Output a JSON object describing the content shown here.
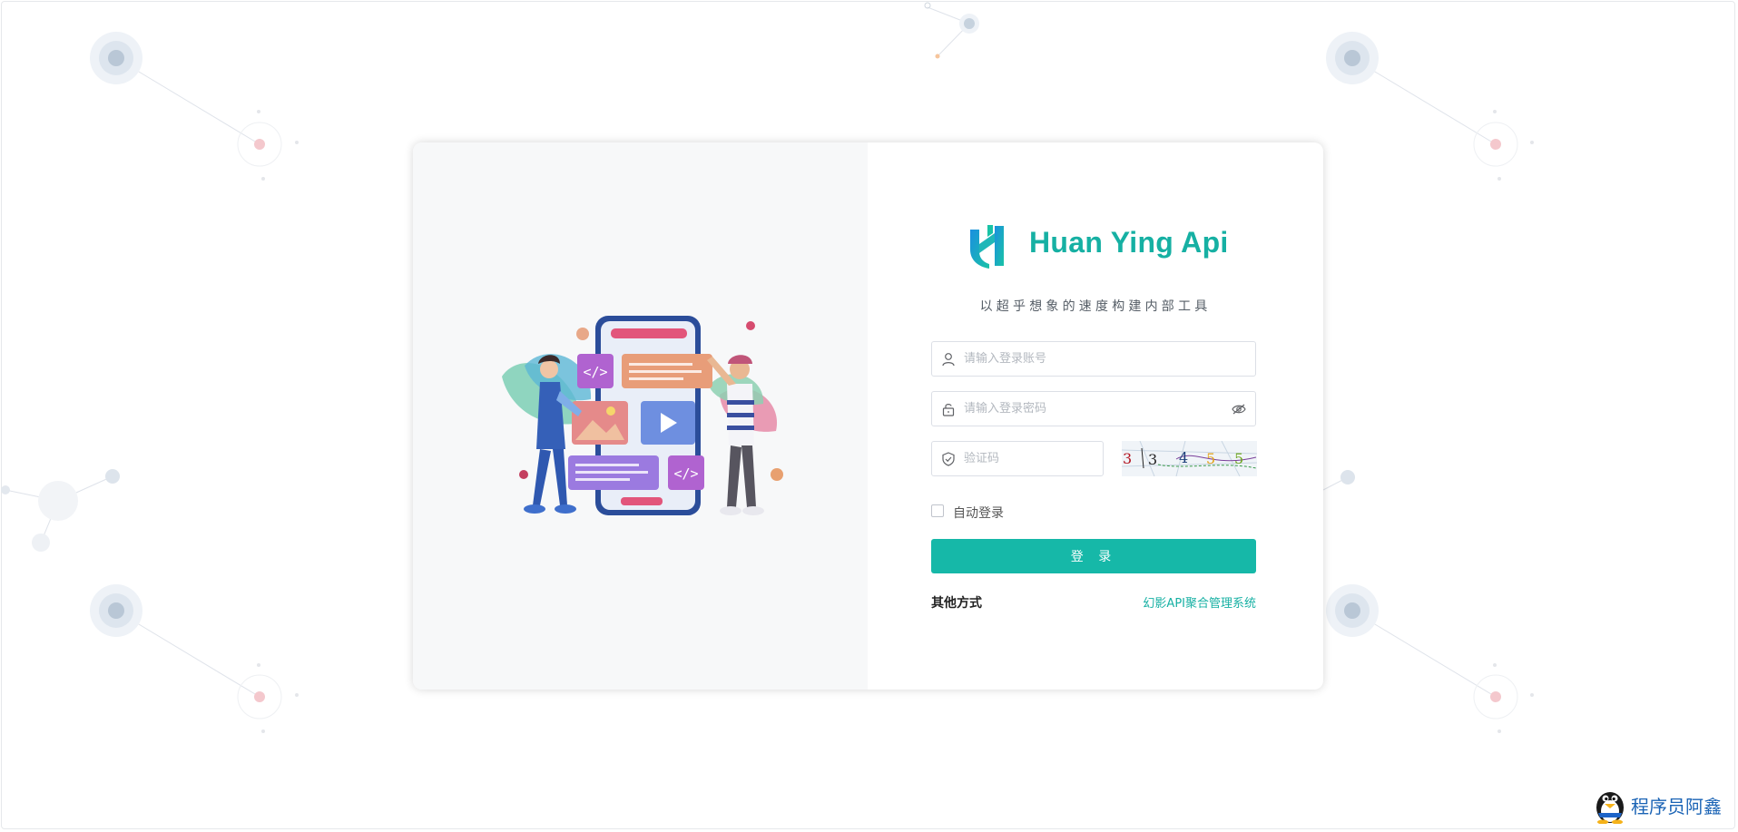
{
  "brand": {
    "name": "Huan Ying Api",
    "slogan": "以超乎想象的速度构建内部工具"
  },
  "form": {
    "username_placeholder": "请输入登录账号",
    "password_placeholder": "请输入登录密码",
    "captcha_placeholder": "验证码",
    "captcha_text": "3 3 4 5 5",
    "remember_label": "自动登录",
    "remember_checked": false,
    "login_label": "登 录",
    "other_methods_label": "其他方式",
    "system_link_label": "幻影API聚合管理系统"
  },
  "watermark": {
    "text": "程序员阿鑫"
  },
  "colors": {
    "accent": "#16b8a8",
    "brand_text": "#16b0a3",
    "watermark_text": "#1a63b5"
  },
  "icons": {
    "username": "user-icon",
    "password": "lock-icon",
    "captcha": "shield-icon",
    "password_toggle": "eye-icon",
    "logo": "hy-logo-icon",
    "watermark": "penguin-icon"
  }
}
